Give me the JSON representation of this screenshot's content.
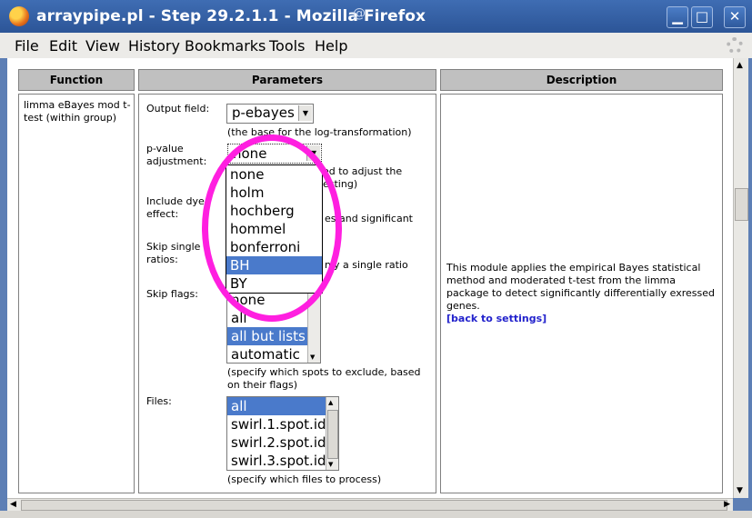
{
  "window": {
    "title": "arraypipe.pl - Step 29.2.1.1 - Mozilla Firefox",
    "buttons": {
      "minimize": "▁",
      "maximize": "□",
      "close": "✕"
    }
  },
  "menu": [
    "File",
    "Edit",
    "View",
    "History",
    "Bookmarks",
    "Tools",
    "Help"
  ],
  "table": {
    "headers": {
      "function": "Function",
      "parameters": "Parameters",
      "description": "Description"
    },
    "function_text": "limma eBayes mod t-test (within group)",
    "description": {
      "text": "This module applies the empirical Bayes statistical method and moderated t-test from the limma package to detect significantly differentially exressed genes.",
      "link": "[back to settings]"
    }
  },
  "params": {
    "output_field": {
      "label": "Output field:",
      "value": "p-ebayes",
      "note": "(the base for the log-transformation)"
    },
    "pvalue_adjustment": {
      "label_line1": "p-value",
      "label_line2": "adjustment:",
      "value": "none",
      "note_line1": "ed to adjust the",
      "note_line2": "esting)",
      "options": [
        "none",
        "holm",
        "hochberg",
        "hommel",
        "bonferroni",
        "BH",
        "BY"
      ],
      "highlighted": "BH"
    },
    "include_dye": {
      "label_line1": "Include dye",
      "label_line2": "effect:",
      "note": "es and significant"
    },
    "skip_single": {
      "label_line1": "Skip single",
      "label_line2": "ratios:",
      "note": "nly a single ratio"
    },
    "skip_flags": {
      "label": "Skip flags:",
      "options": [
        "none",
        "all",
        "all but lists",
        "automatic"
      ],
      "selected": "all but lists",
      "note_line1": "(specify which spots to exclude, based",
      "note_line2": "on their flags)"
    },
    "files": {
      "label": "Files:",
      "options": [
        "all",
        "swirl.1.spot.id",
        "swirl.2.spot.id",
        "swirl.3.spot.id"
      ],
      "selected": "all",
      "note": "(specify which files to process)"
    }
  },
  "colors": {
    "titlebar": "#3f6db3",
    "selection": "#4a7acb",
    "highlight_ring": "#ff1fe0",
    "link": "#2222cc"
  }
}
